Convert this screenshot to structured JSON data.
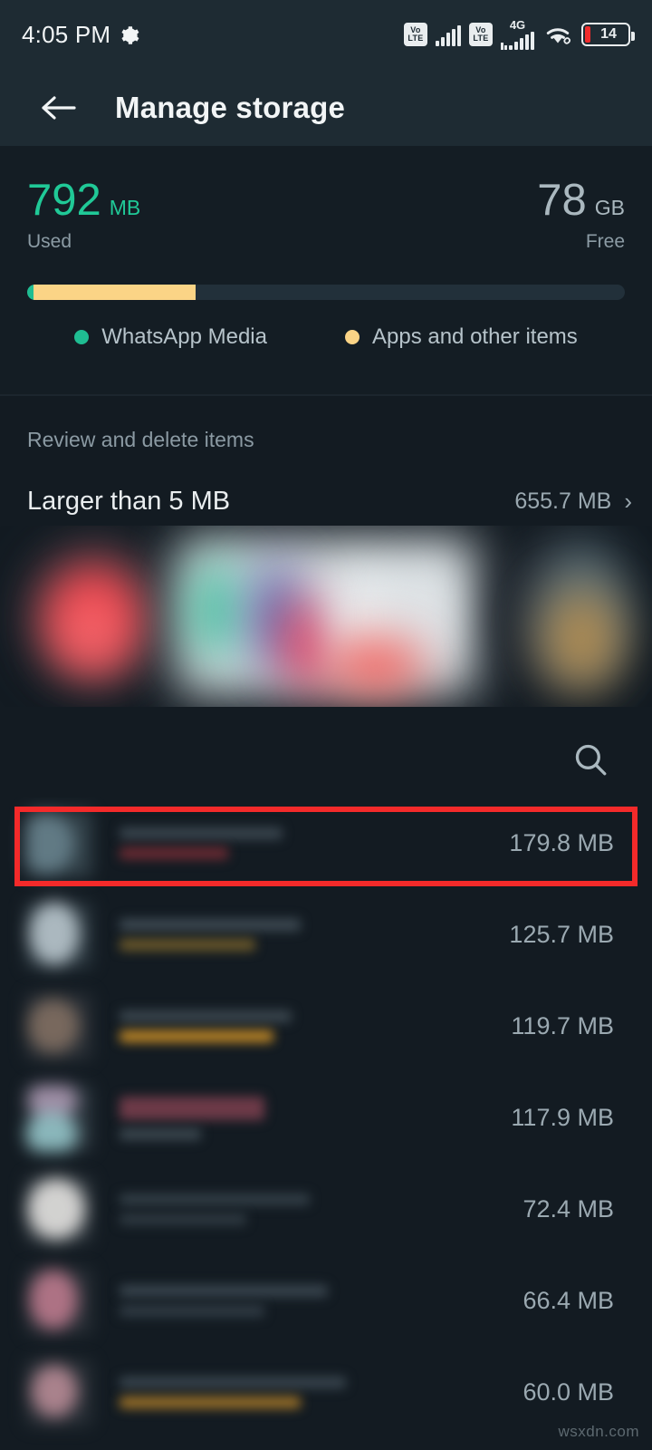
{
  "status_bar": {
    "time": "4:05 PM",
    "gear_icon": "gear-icon",
    "sim1_volte": "VoLTE",
    "sim2_volte": "VoLTE",
    "network_type": "4G",
    "wifi_icon": "wifi-icon",
    "battery_percent": "14"
  },
  "app_bar": {
    "back_icon": "back-arrow-icon",
    "title": "Manage storage"
  },
  "summary": {
    "used_value": "792",
    "used_unit": "MB",
    "used_caption": "Used",
    "free_value": "78",
    "free_unit": "GB",
    "free_caption": "Free",
    "legend": [
      {
        "label": "WhatsApp Media",
        "color": "#1fbd92"
      },
      {
        "label": "Apps and other items",
        "color": "#fbd486"
      }
    ]
  },
  "review": {
    "section_title": "Review and delete items",
    "larger_label": "Larger than 5 MB",
    "larger_size": "655.7 MB",
    "chevron": "›"
  },
  "search": {
    "icon": "search-icon"
  },
  "items": [
    {
      "size": "179.8 MB",
      "highlighted": true
    },
    {
      "size": "125.7 MB",
      "highlighted": false
    },
    {
      "size": "119.7 MB",
      "highlighted": false
    },
    {
      "size": "117.9 MB",
      "highlighted": false
    },
    {
      "size": "72.4 MB",
      "highlighted": false
    },
    {
      "size": "66.4 MB",
      "highlighted": false
    },
    {
      "size": "60.0 MB",
      "highlighted": false
    }
  ],
  "watermark": "wsxdn.com",
  "colors": {
    "status_bar_bg": "#1e2b33",
    "app_bar_bg": "#1e2b33",
    "page_bg": "#131b22",
    "accent_teal": "#20c997",
    "accent_amber": "#fbd486",
    "highlight_red": "#f42a2a",
    "battery_low_red": "#f02c2c"
  }
}
